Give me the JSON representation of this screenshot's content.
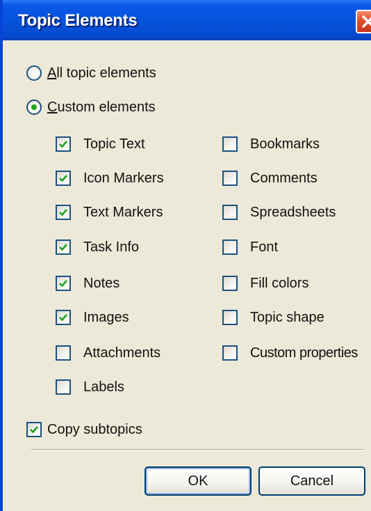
{
  "window": {
    "title": "Topic Elements"
  },
  "scope": {
    "all": {
      "underline_char": "A",
      "label_rest": "ll topic elements",
      "selected": false
    },
    "custom": {
      "underline_char": "C",
      "label_rest": "ustom elements",
      "selected": true
    }
  },
  "elements_left": [
    {
      "label": "Topic Text",
      "checked": true
    },
    {
      "label": "Icon Markers",
      "checked": true
    },
    {
      "label": "Text Markers",
      "checked": true
    },
    {
      "label": "Task Info",
      "checked": true
    },
    {
      "label": "Notes",
      "checked": true
    },
    {
      "label": "Images",
      "checked": true
    },
    {
      "label": "Attachments",
      "checked": false
    },
    {
      "label": "Labels",
      "checked": false
    }
  ],
  "elements_right": [
    {
      "label": "Bookmarks",
      "checked": false
    },
    {
      "label": "Comments",
      "checked": false
    },
    {
      "label": "Spreadsheets",
      "checked": false
    },
    {
      "label": "Font",
      "checked": false
    },
    {
      "label": "Fill colors",
      "checked": false
    },
    {
      "label": "Topic shape",
      "checked": false
    },
    {
      "label": "Custom properties",
      "checked": false
    }
  ],
  "copy_subtopics": {
    "label": "Copy subtopics",
    "checked": true
  },
  "buttons": {
    "ok": "OK",
    "cancel": "Cancel"
  },
  "colors": {
    "title_bar": "#0552dd",
    "check_mark": "#21a121",
    "close_button": "#e0522c",
    "dialog_bg": "#ece9d8"
  },
  "icons": {
    "close": "close-icon",
    "check": "check-icon"
  }
}
